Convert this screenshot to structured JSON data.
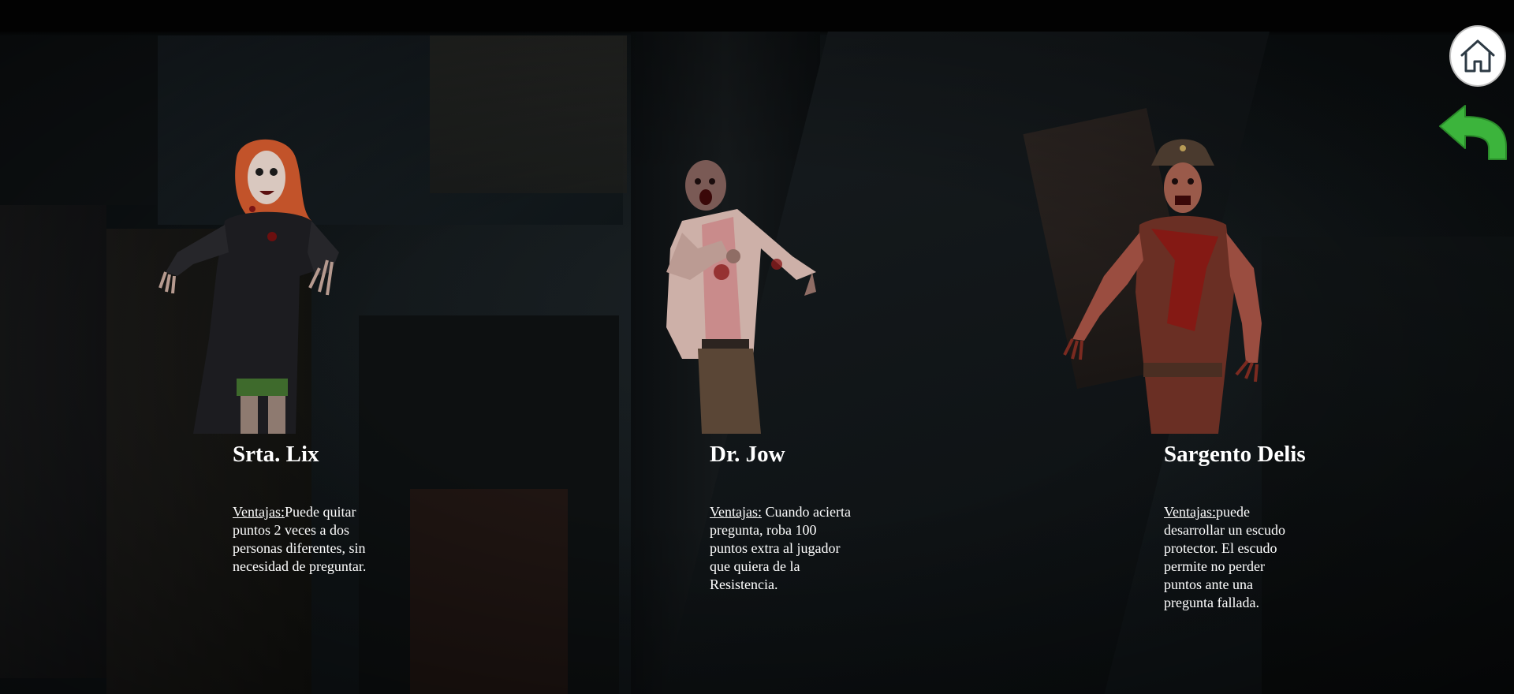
{
  "navigation": {
    "home_icon": "home-icon",
    "back_icon": "back-arrow-icon",
    "back_color": "#3cb43c"
  },
  "characters": [
    {
      "name": "Srta. Lix",
      "advantage_label": "Ventajas:",
      "advantage_text": "Puede quitar puntos 2 veces a dos personas diferentes, sin necesidad de preguntar."
    },
    {
      "name": "Dr. Jow",
      "advantage_label": "Ventajas:",
      "advantage_text": " Cuando acierta pregunta, roba 100 puntos extra al jugador que quiera de la Resistencia."
    },
    {
      "name": "Sargento Delis",
      "advantage_label": "Ventajas:",
      "advantage_text": "puede desarrollar un escudo protector. El escudo permite no perder puntos ante una pregunta fallada."
    }
  ]
}
